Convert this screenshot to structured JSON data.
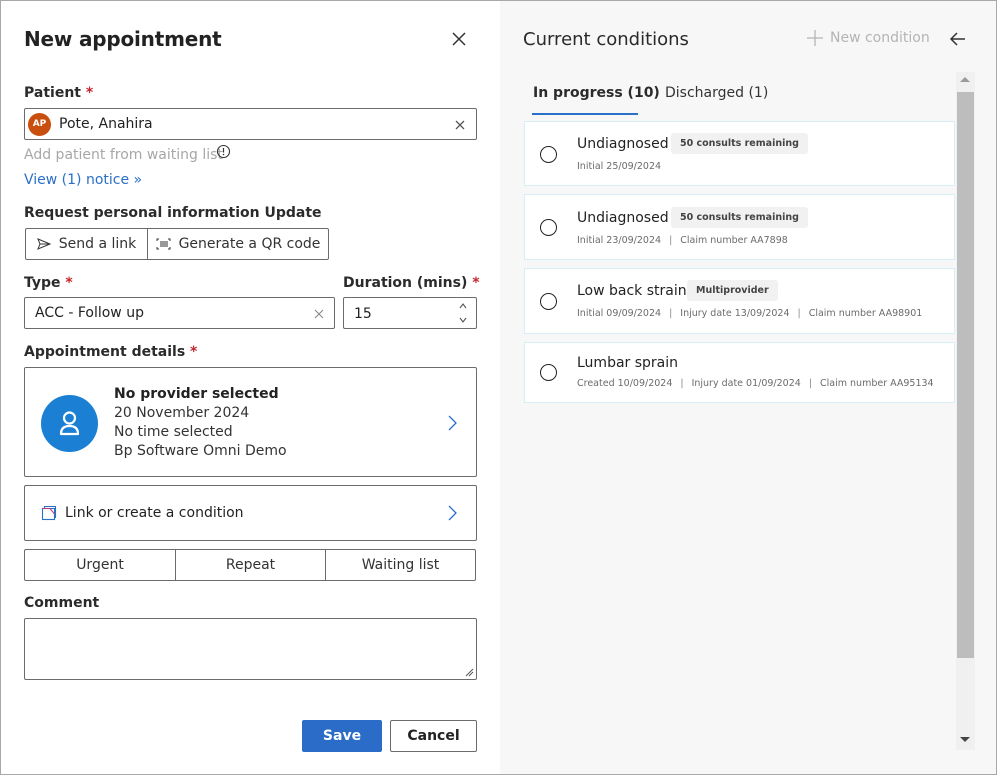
{
  "dialog": {
    "title": "New appointment",
    "close_icon": "close-icon"
  },
  "patient": {
    "label": "Patient",
    "required_mark": "*",
    "avatar_initials": "AP",
    "avatar_color": "#c94f0f",
    "value": "Pote, Anahira",
    "add_from_waiting_list": "Add patient from waiting list",
    "info_icon": "info-icon",
    "notice_link": "View (1) notice",
    "notice_chevron": "»"
  },
  "personal_info": {
    "label": "Request personal information Update",
    "send_link": "Send a link",
    "generate_qr": "Generate a QR code"
  },
  "type": {
    "label": "Type",
    "required_mark": "*",
    "value": "ACC - Follow up"
  },
  "duration": {
    "label": "Duration (mins)",
    "required_mark": "*",
    "value": "15"
  },
  "appointment_details": {
    "label": "Appointment details",
    "required_mark": "*",
    "provider": "No provider selected",
    "date": "20 November 2024",
    "time": "No time selected",
    "location": "Bp Software Omni Demo"
  },
  "condition_link": {
    "label": "Link or create a condition"
  },
  "flags": {
    "urgent": "Urgent",
    "repeat": "Repeat",
    "waiting_list": "Waiting list"
  },
  "comment": {
    "label": "Comment",
    "value": ""
  },
  "actions": {
    "save": "Save",
    "cancel": "Cancel",
    "primary_color": "#2b6cc9"
  },
  "conditions_panel": {
    "title": "Current conditions",
    "new_condition": "New condition",
    "tabs": [
      {
        "label": "In progress (10)",
        "active": true
      },
      {
        "label": "Discharged (1)",
        "active": false
      }
    ],
    "items": [
      {
        "name": "Undiagnosed",
        "badge": "50 consults remaining",
        "meta": [
          "Initial 25/09/2024"
        ]
      },
      {
        "name": "Undiagnosed",
        "badge": "50 consults remaining",
        "meta": [
          "Initial 23/09/2024",
          "Claim number AA7898"
        ]
      },
      {
        "name": "Low back strain",
        "badge": "Multiprovider",
        "meta": [
          "Initial 09/09/2024",
          "Injury date 13/09/2024",
          "Claim number AA98901"
        ]
      },
      {
        "name": "Lumbar sprain",
        "badge": null,
        "meta": [
          "Created 10/09/2024",
          "Injury date 01/09/2024",
          "Claim number AA95134"
        ]
      }
    ],
    "separator": "|"
  }
}
